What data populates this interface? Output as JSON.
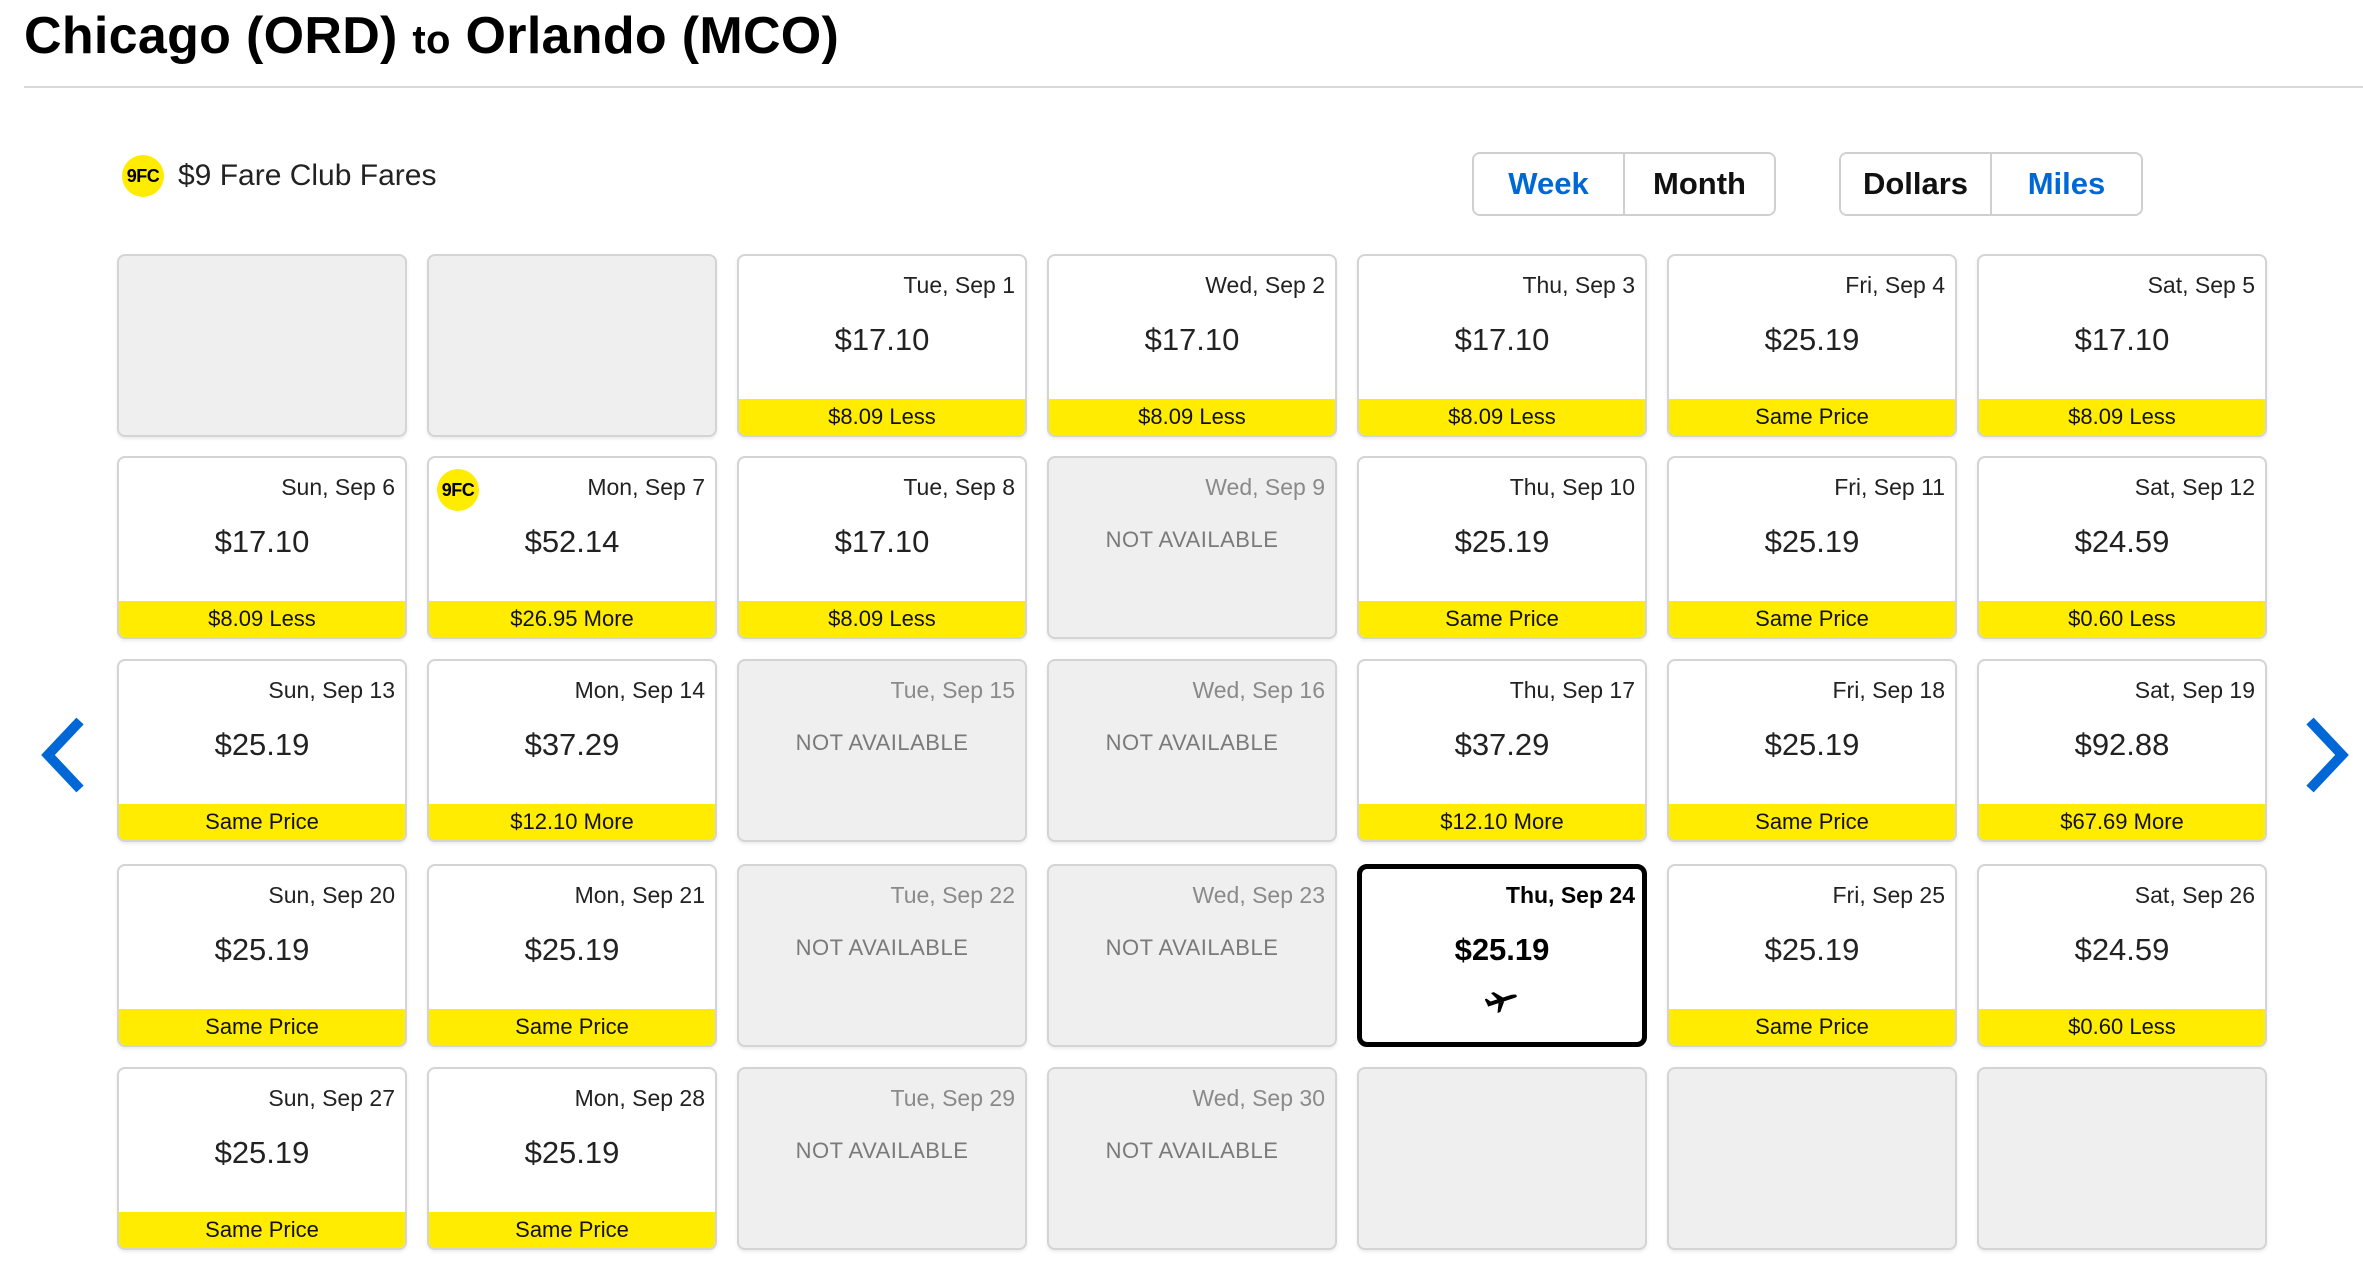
{
  "header": {
    "origin": "Chicago (ORD)",
    "connector": "to",
    "destination": "Orlando (MCO)"
  },
  "legend": {
    "badge": "9FC",
    "label": "$9 Fare Club Fares"
  },
  "view_toggle": {
    "week": "Week",
    "month": "Month",
    "active": "Month"
  },
  "currency_toggle": {
    "dollars": "Dollars",
    "miles": "Miles",
    "active": "Dollars"
  },
  "nav": {
    "prev_icon": "chevron-left-icon",
    "next_icon": "chevron-right-icon"
  },
  "colors": {
    "accent_yellow": "#ffec00",
    "link_blue": "#0067d6",
    "unavailable_bg": "#efefef"
  },
  "calendar": {
    "not_available_label": "NOT AVAILABLE",
    "cells": [
      {
        "type": "empty"
      },
      {
        "type": "empty"
      },
      {
        "type": "fare",
        "date": "Tue, Sep 1",
        "price": "$17.10",
        "diff": "$8.09 Less"
      },
      {
        "type": "fare",
        "date": "Wed, Sep 2",
        "price": "$17.10",
        "diff": "$8.09 Less"
      },
      {
        "type": "fare",
        "date": "Thu, Sep 3",
        "price": "$17.10",
        "diff": "$8.09 Less"
      },
      {
        "type": "fare",
        "date": "Fri, Sep 4",
        "price": "$25.19",
        "diff": "Same Price"
      },
      {
        "type": "fare",
        "date": "Sat, Sep 5",
        "price": "$17.10",
        "diff": "$8.09 Less"
      },
      {
        "type": "fare",
        "date": "Sun, Sep 6",
        "price": "$17.10",
        "diff": "$8.09 Less"
      },
      {
        "type": "fare",
        "date": "Mon, Sep 7",
        "price": "$52.14",
        "diff": "$26.95 More",
        "badge": "9FC"
      },
      {
        "type": "fare",
        "date": "Tue, Sep 8",
        "price": "$17.10",
        "diff": "$8.09 Less"
      },
      {
        "type": "na",
        "date": "Wed, Sep 9"
      },
      {
        "type": "fare",
        "date": "Thu, Sep 10",
        "price": "$25.19",
        "diff": "Same Price"
      },
      {
        "type": "fare",
        "date": "Fri, Sep 11",
        "price": "$25.19",
        "diff": "Same Price"
      },
      {
        "type": "fare",
        "date": "Sat, Sep 12",
        "price": "$24.59",
        "diff": "$0.60 Less"
      },
      {
        "type": "fare",
        "date": "Sun, Sep 13",
        "price": "$25.19",
        "diff": "Same Price"
      },
      {
        "type": "fare",
        "date": "Mon, Sep 14",
        "price": "$37.29",
        "diff": "$12.10 More"
      },
      {
        "type": "na",
        "date": "Tue, Sep 15"
      },
      {
        "type": "na",
        "date": "Wed, Sep 16"
      },
      {
        "type": "fare",
        "date": "Thu, Sep 17",
        "price": "$37.29",
        "diff": "$12.10 More"
      },
      {
        "type": "fare",
        "date": "Fri, Sep 18",
        "price": "$25.19",
        "diff": "Same Price"
      },
      {
        "type": "fare",
        "date": "Sat, Sep 19",
        "price": "$92.88",
        "diff": "$67.69 More"
      },
      {
        "type": "fare",
        "date": "Sun, Sep 20",
        "price": "$25.19",
        "diff": "Same Price"
      },
      {
        "type": "fare",
        "date": "Mon, Sep 21",
        "price": "$25.19",
        "diff": "Same Price"
      },
      {
        "type": "na",
        "date": "Tue, Sep 22"
      },
      {
        "type": "na",
        "date": "Wed, Sep 23"
      },
      {
        "type": "selected",
        "date": "Thu, Sep 24",
        "price": "$25.19",
        "icon": "plane-icon"
      },
      {
        "type": "fare",
        "date": "Fri, Sep 25",
        "price": "$25.19",
        "diff": "Same Price"
      },
      {
        "type": "fare",
        "date": "Sat, Sep 26",
        "price": "$24.59",
        "diff": "$0.60 Less"
      },
      {
        "type": "fare",
        "date": "Sun, Sep 27",
        "price": "$25.19",
        "diff": "Same Price"
      },
      {
        "type": "fare",
        "date": "Mon, Sep 28",
        "price": "$25.19",
        "diff": "Same Price"
      },
      {
        "type": "na",
        "date": "Tue, Sep 29"
      },
      {
        "type": "na",
        "date": "Wed, Sep 30"
      },
      {
        "type": "empty"
      },
      {
        "type": "empty"
      },
      {
        "type": "empty"
      }
    ]
  }
}
